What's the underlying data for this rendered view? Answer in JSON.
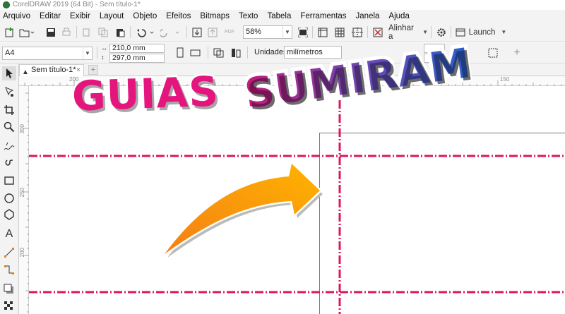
{
  "window": {
    "title": "CorelDRAW 2019 (64 Bit) - Sem título-1*"
  },
  "menu": [
    "Arquivo",
    "Editar",
    "Exibir",
    "Layout",
    "Objeto",
    "Efeitos",
    "Bitmaps",
    "Texto",
    "Tabela",
    "Ferramentas",
    "Janela",
    "Ajuda"
  ],
  "toolbar": {
    "zoom": "58%",
    "align_label": "Alinhar a",
    "launch_label": "Launch"
  },
  "properties": {
    "page_size": "A4",
    "width": "210,0 mm",
    "height": "297,0 mm",
    "units_label": "Unidades:",
    "units_value": "milímetros"
  },
  "document_tab": {
    "label": "Sem título-1*"
  },
  "ruler": {
    "h_labels": [
      "200",
      "150"
    ],
    "v_labels": [
      "300",
      "250",
      "200"
    ]
  },
  "overlay": {
    "word1": "GUIAS",
    "word2": "SUMIRAM"
  },
  "colors": {
    "guide": "#d8195f",
    "arrow_start": "#f47f16",
    "arrow_end": "#ffb300",
    "headline_pink": "#e4167e",
    "headline_blue": "#2a5fc8"
  }
}
